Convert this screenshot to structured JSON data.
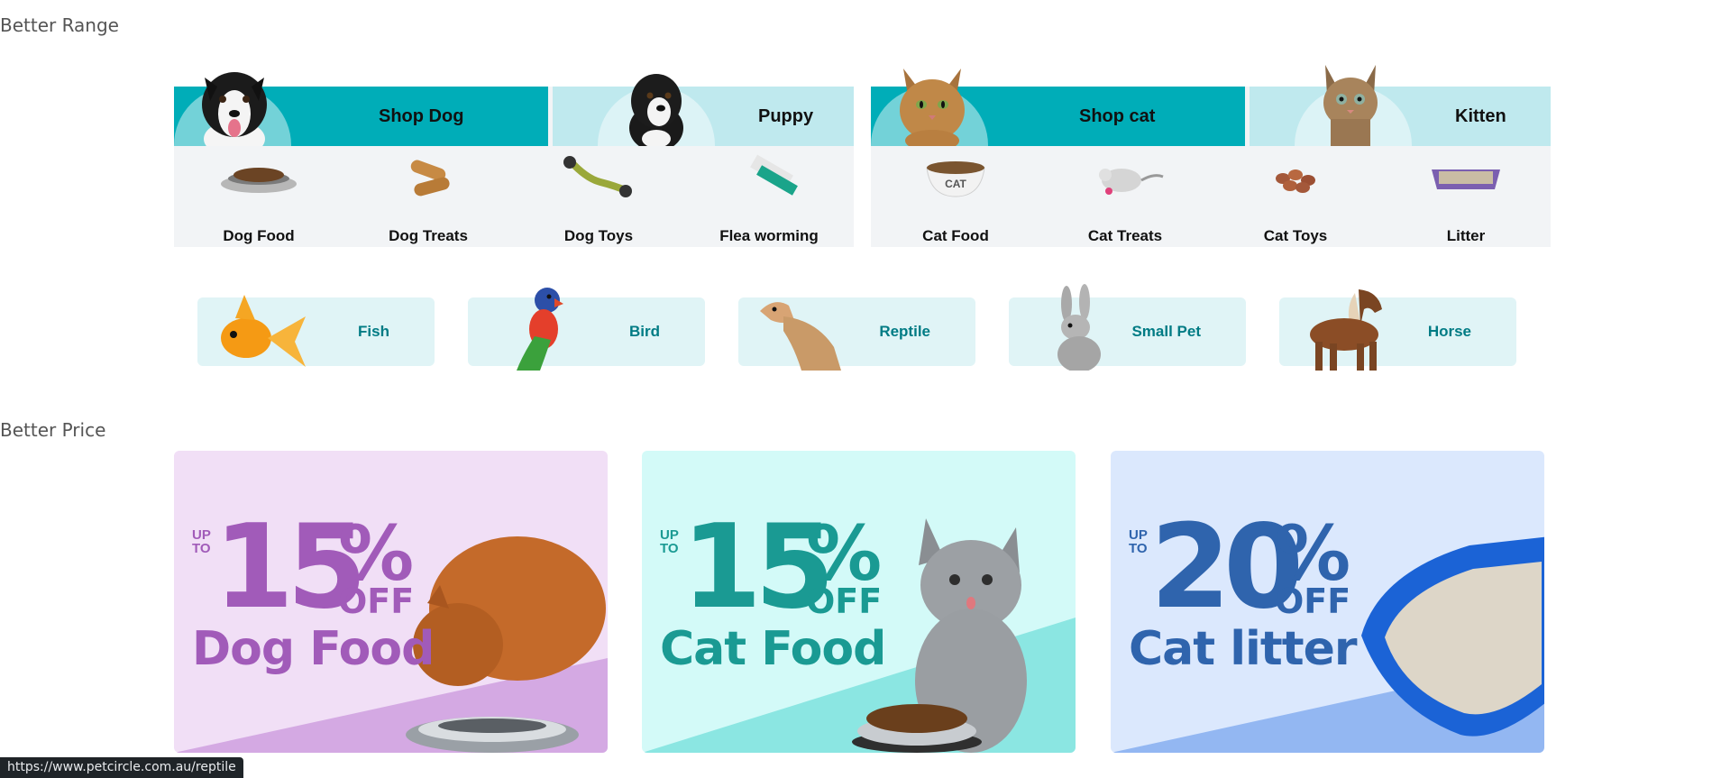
{
  "sections": {
    "range_title": "Better Range",
    "price_title": "Better Price"
  },
  "dog_block": {
    "shop_label": "Shop Dog",
    "young_label": "Puppy",
    "items": [
      "Dog Food",
      "Dog Treats",
      "Dog Toys",
      "Flea worming"
    ]
  },
  "cat_block": {
    "shop_label": "Shop cat",
    "young_label": "Kitten",
    "items": [
      "Cat Food",
      "Cat Treats",
      "Cat Toys",
      "Litter"
    ]
  },
  "other_pets": [
    "Fish",
    "Bird",
    "Reptile",
    "Small Pet",
    "Horse"
  ],
  "promos": [
    {
      "upto": "UP TO",
      "number": "15",
      "percent": "%",
      "off": "OFF",
      "product": "Dog Food",
      "color": "#a15bb9"
    },
    {
      "upto": "UP TO",
      "number": "15",
      "percent": "%",
      "off": "OFF",
      "product": "Cat Food",
      "color": "#1a9a93"
    },
    {
      "upto": "UP TO",
      "number": "20",
      "percent": "%",
      "off": "OFF",
      "product": "Cat litter",
      "color": "#2f64ad"
    }
  ],
  "status_bar": {
    "url": "https://www.petcircle.com.au/reptile"
  },
  "colors": {
    "banner_dark": "#00adb8",
    "banner_light": "#bfe9ee",
    "tile_bg": "#e0f4f6",
    "tile_text": "#007b84"
  }
}
